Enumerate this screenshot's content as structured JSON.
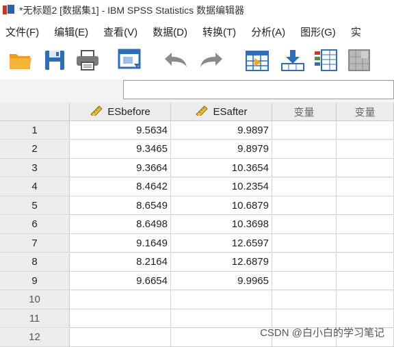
{
  "window": {
    "title": "*无标题2 [数据集1] - IBM SPSS Statistics 数据编辑器"
  },
  "menu": [
    "文件(F)",
    "编辑(E)",
    "查看(V)",
    "数据(D)",
    "转换(T)",
    "分析(A)",
    "图形(G)",
    "实"
  ],
  "toolbar": {
    "icons": [
      "open-folder-icon",
      "save-icon",
      "print-icon",
      "dialog-recall-icon",
      "undo-icon",
      "redo-icon",
      "goto-case-icon",
      "insert-cases-icon",
      "variables-icon",
      "value-labels-icon"
    ]
  },
  "colors": {
    "accent": "#2f6db5",
    "folder": "#f0a830",
    "header_bg": "#ececec"
  },
  "grid": {
    "columns": [
      "ESbefore",
      "ESafter",
      "变量",
      "变量"
    ],
    "rows": [
      {
        "num": "1",
        "ESbefore": "9.5634",
        "ESafter": "9.9897"
      },
      {
        "num": "2",
        "ESbefore": "9.3465",
        "ESafter": "9.8979"
      },
      {
        "num": "3",
        "ESbefore": "9.3664",
        "ESafter": "10.3654"
      },
      {
        "num": "4",
        "ESbefore": "8.4642",
        "ESafter": "10.2354"
      },
      {
        "num": "5",
        "ESbefore": "8.6549",
        "ESafter": "10.6879"
      },
      {
        "num": "6",
        "ESbefore": "8.6498",
        "ESafter": "10.3698"
      },
      {
        "num": "7",
        "ESbefore": "9.1649",
        "ESafter": "12.6597"
      },
      {
        "num": "8",
        "ESbefore": "8.2164",
        "ESafter": "12.6879"
      },
      {
        "num": "9",
        "ESbefore": "9.6654",
        "ESafter": "9.9965"
      },
      {
        "num": "10",
        "ESbefore": "",
        "ESafter": ""
      },
      {
        "num": "11",
        "ESbefore": "",
        "ESafter": ""
      },
      {
        "num": "12",
        "ESbefore": "",
        "ESafter": ""
      }
    ]
  },
  "watermark": "CSDN @白小白的学习笔记"
}
